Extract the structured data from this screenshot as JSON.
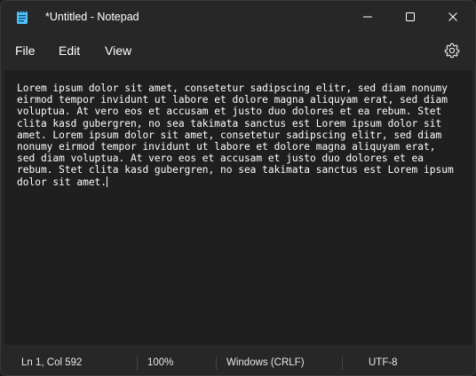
{
  "window": {
    "title": "*Untitled - Notepad",
    "app_icon": "notepad-icon",
    "controls": {
      "minimize_icon": "minimize-icon",
      "maximize_icon": "maximize-icon",
      "close_icon": "close-icon"
    }
  },
  "menu": {
    "file": "File",
    "edit": "Edit",
    "view": "View",
    "settings_icon": "gear-icon"
  },
  "editor": {
    "content": "Lorem ipsum dolor sit amet, consetetur sadipscing elitr, sed diam nonumy\neirmod tempor invidunt ut labore et dolore magna aliquyam erat, sed diam\nvoluptua. At vero eos et accusam et justo duo dolores et ea rebum. Stet\nclita kasd gubergren, no sea takimata sanctus est Lorem ipsum dolor sit\namet. Lorem ipsum dolor sit amet, consetetur sadipscing elitr, sed diam\nnonumy eirmod tempor invidunt ut labore et dolore magna aliquyam erat,\nsed diam voluptua. At vero eos et accusam et justo duo dolores et ea\nrebum. Stet clita kasd gubergren, no sea takimata sanctus est Lorem ipsum\ndolor sit amet."
  },
  "status": {
    "position": "Ln 1, Col 592",
    "zoom": "100%",
    "line_ending": "Windows (CRLF)",
    "encoding": "UTF-8"
  },
  "colors": {
    "window_bg": "#272727",
    "editor_bg": "#1f1f1f",
    "text": "#ffffff",
    "icon_accent": "#4cc2ff"
  }
}
